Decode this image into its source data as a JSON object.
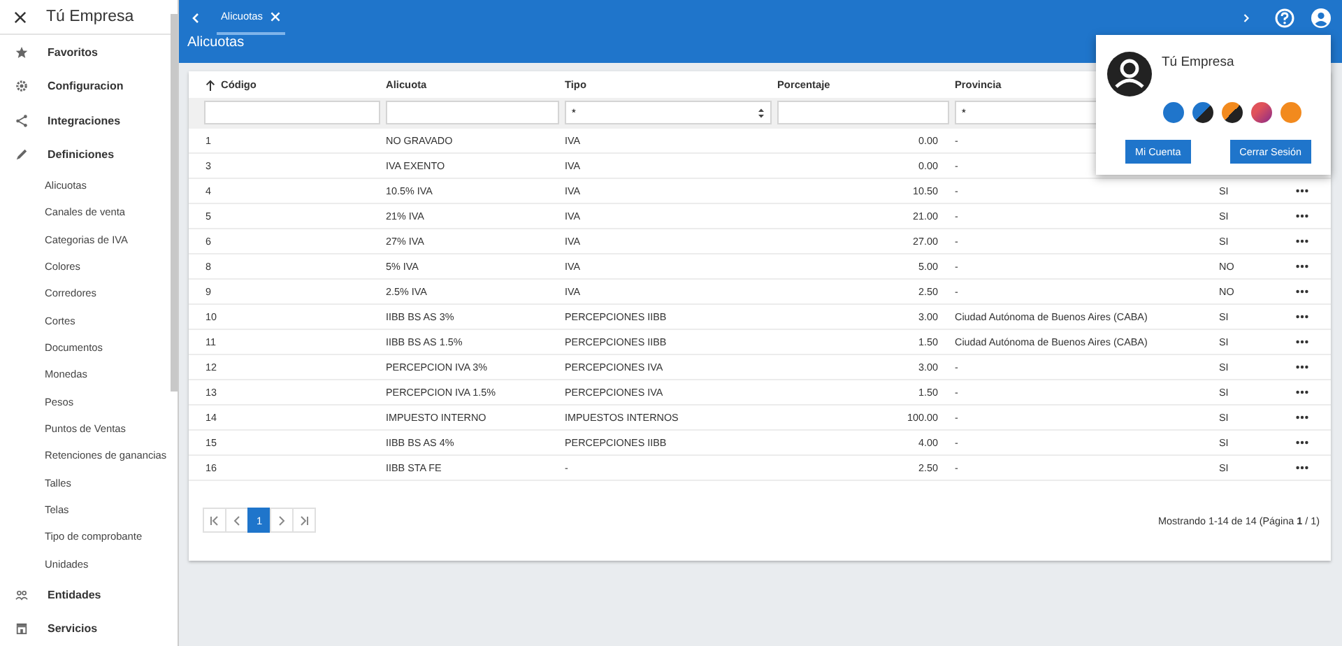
{
  "sidebar": {
    "title": "Tú Empresa",
    "items": [
      {
        "kind": "section",
        "label": "Favoritos"
      },
      {
        "kind": "section",
        "label": "Configuracion"
      },
      {
        "kind": "section",
        "label": "Integraciones"
      },
      {
        "kind": "section",
        "label": "Definiciones"
      },
      {
        "kind": "item",
        "label": "Alicuotas"
      },
      {
        "kind": "item",
        "label": "Canales de venta"
      },
      {
        "kind": "item",
        "label": "Categorias de IVA"
      },
      {
        "kind": "item",
        "label": "Colores"
      },
      {
        "kind": "item",
        "label": "Corredores"
      },
      {
        "kind": "item",
        "label": "Cortes"
      },
      {
        "kind": "item",
        "label": "Documentos"
      },
      {
        "kind": "item",
        "label": "Monedas"
      },
      {
        "kind": "item",
        "label": "Pesos"
      },
      {
        "kind": "item",
        "label": "Puntos de Ventas"
      },
      {
        "kind": "item",
        "label": "Retenciones de ganancias"
      },
      {
        "kind": "item",
        "label": "Talles"
      },
      {
        "kind": "item",
        "label": "Telas"
      },
      {
        "kind": "item",
        "label": "Tipo de comprobante"
      },
      {
        "kind": "item",
        "label": "Unidades"
      },
      {
        "kind": "section",
        "label": "Entidades"
      },
      {
        "kind": "section",
        "label": "Servicios"
      }
    ]
  },
  "tabs": [
    {
      "label": "Alicuotas",
      "selected": true
    }
  ],
  "page_title": "Alicuotas",
  "table": {
    "columns": [
      {
        "label": "Código",
        "sorted": true
      },
      {
        "label": "Alicuota",
        "sorted": false
      },
      {
        "label": "Tipo",
        "sorted": false
      },
      {
        "label": "Porcentaje",
        "sorted": false
      },
      {
        "label": "Provincia",
        "sorted": false
      }
    ],
    "filters": [
      {
        "kind": "text"
      },
      {
        "kind": "text"
      },
      {
        "kind": "select",
        "value": "*"
      },
      {
        "kind": "text"
      },
      {
        "kind": "select",
        "value": "*"
      }
    ],
    "rows": [
      {
        "codigo": "1",
        "alicuota": "NO GRAVADO",
        "tipo": "IVA",
        "porcentaje": "0.00",
        "provincia": "-"
      },
      {
        "codigo": "3",
        "alicuota": "IVA EXENTO",
        "tipo": "IVA",
        "porcentaje": "0.00",
        "provincia": "-"
      },
      {
        "codigo": "4",
        "alicuota": "10.5% IVA",
        "tipo": "IVA",
        "porcentaje": "10.50",
        "provincia": "-",
        "column_6": "SI"
      },
      {
        "codigo": "5",
        "alicuota": "21% IVA",
        "tipo": "IVA",
        "porcentaje": "21.00",
        "provincia": "-",
        "column_6": "SI"
      },
      {
        "codigo": "6",
        "alicuota": "27% IVA",
        "tipo": "IVA",
        "porcentaje": "27.00",
        "provincia": "-",
        "column_6": "SI"
      },
      {
        "codigo": "8",
        "alicuota": "5% IVA",
        "tipo": "IVA",
        "porcentaje": "5.00",
        "provincia": "-",
        "column_6": "NO"
      },
      {
        "codigo": "9",
        "alicuota": "2.5% IVA",
        "tipo": "IVA",
        "porcentaje": "2.50",
        "provincia": "-",
        "column_6": "NO"
      },
      {
        "codigo": "10",
        "alicuota": "IIBB BS AS 3%",
        "tipo": "PERCEPCIONES IIBB",
        "porcentaje": "3.00",
        "provincia": "Ciudad Autónoma de Buenos Aires (CABA)",
        "column_6": "SI"
      },
      {
        "codigo": "11",
        "alicuota": "IIBB BS AS 1.5%",
        "tipo": "PERCEPCIONES IIBB",
        "porcentaje": "1.50",
        "provincia": "Ciudad Autónoma de Buenos Aires (CABA)",
        "column_6": "SI"
      },
      {
        "codigo": "12",
        "alicuota": "PERCEPCION IVA 3%",
        "tipo": "PERCEPCIONES IVA",
        "porcentaje": "3.00",
        "provincia": "-",
        "column_6": "SI"
      },
      {
        "codigo": "13",
        "alicuota": "PERCEPCION IVA 1.5%",
        "tipo": "PERCEPCIONES IVA",
        "porcentaje": "1.50",
        "provincia": "-",
        "column_6": "SI"
      },
      {
        "codigo": "14",
        "alicuota": "IMPUESTO INTERNO",
        "tipo": "IMPUESTOS INTERNOS",
        "porcentaje": "100.00",
        "provincia": "-",
        "column_6": "SI"
      },
      {
        "codigo": "15",
        "alicuota": "IIBB BS AS 4%",
        "tipo": "PERCEPCIONES IIBB",
        "porcentaje": "4.00",
        "provincia": "-",
        "column_6": "SI"
      },
      {
        "codigo": "16",
        "alicuota": "IIBB STA FE",
        "tipo": "-",
        "porcentaje": "2.50",
        "provincia": "-",
        "column_6": "SI"
      }
    ]
  },
  "pagination": {
    "pages": [
      {
        "label": "1",
        "selected": true
      }
    ],
    "summary": "Mostrando 1-14 de 14 (Página **1** / 1)"
  },
  "account_popup": {
    "name": "Tú Empresa",
    "swatches": [
      {
        "kind": "solid",
        "color": "#1f75cb"
      },
      {
        "kind": "split",
        "color": "#1f75cb"
      },
      {
        "kind": "split",
        "color": "#f28a1e"
      },
      {
        "kind": "gradient",
        "color": "#e0525a"
      },
      {
        "kind": "solid",
        "color": "#f28a1e"
      }
    ],
    "buttons": [
      "Mi Cuenta",
      "Cerrar Sesión"
    ]
  }
}
